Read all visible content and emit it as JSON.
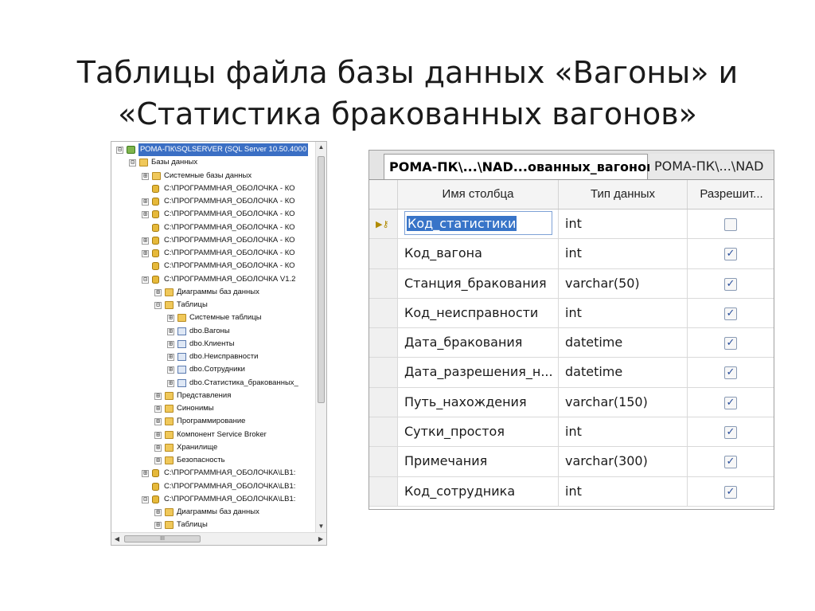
{
  "slide": {
    "title_line1": "Таблицы файла базы данных «Вагоны» и",
    "title_line2": "«Статистика бракованных вагонов»"
  },
  "object_explorer": {
    "nodes": [
      {
        "text": "РОМА-ПК\\SQLSERVER (SQL Server 10.50.4000",
        "expander": "⊟",
        "icon": "server-icon",
        "level": 0,
        "selected": true
      },
      {
        "text": "Базы данных",
        "expander": "⊟",
        "icon": "folder-icon",
        "level": 1
      },
      {
        "text": "Системные базы данных",
        "expander": "⊞",
        "icon": "folder-icon",
        "level": 2
      },
      {
        "text": "C:\\ПРОГРАММНАЯ_ОБОЛОЧКА - КО",
        "expander": "",
        "icon": "database-icon",
        "level": 2
      },
      {
        "text": "C:\\ПРОГРАММНАЯ_ОБОЛОЧКА - КО",
        "expander": "⊞",
        "icon": "database-icon",
        "level": 2
      },
      {
        "text": "C:\\ПРОГРАММНАЯ_ОБОЛОЧКА - КО",
        "expander": "⊞",
        "icon": "database-icon",
        "level": 2
      },
      {
        "text": "C:\\ПРОГРАММНАЯ_ОБОЛОЧКА - КО",
        "expander": "",
        "icon": "database-icon",
        "level": 2
      },
      {
        "text": "C:\\ПРОГРАММНАЯ_ОБОЛОЧКА - КО",
        "expander": "⊞",
        "icon": "database-icon",
        "level": 2
      },
      {
        "text": "C:\\ПРОГРАММНАЯ_ОБОЛОЧКА - КО",
        "expander": "⊞",
        "icon": "database-icon",
        "level": 2
      },
      {
        "text": "C:\\ПРОГРАММНАЯ_ОБОЛОЧКА - КО",
        "expander": "",
        "icon": "database-icon",
        "level": 2
      },
      {
        "text": "C:\\ПРОГРАММНАЯ_ОБОЛОЧКА V1.2",
        "expander": "⊟",
        "icon": "database-icon",
        "level": 2
      },
      {
        "text": "Диаграммы баз данных",
        "expander": "⊞",
        "icon": "folder-icon",
        "level": 3
      },
      {
        "text": "Таблицы",
        "expander": "⊟",
        "icon": "folder-icon",
        "level": 3
      },
      {
        "text": "Системные таблицы",
        "expander": "⊞",
        "icon": "folder-icon",
        "level": 4
      },
      {
        "text": "dbo.Вагоны",
        "expander": "⊞",
        "icon": "table-icon",
        "level": 4
      },
      {
        "text": "dbo.Клиенты",
        "expander": "⊞",
        "icon": "table-icon",
        "level": 4
      },
      {
        "text": "dbo.Неисправности",
        "expander": "⊞",
        "icon": "table-icon",
        "level": 4
      },
      {
        "text": "dbo.Сотрудники",
        "expander": "⊞",
        "icon": "table-icon",
        "level": 4
      },
      {
        "text": "dbo.Статистика_бракованных_",
        "expander": "⊞",
        "icon": "table-icon",
        "level": 4
      },
      {
        "text": "Представления",
        "expander": "⊞",
        "icon": "folder-icon",
        "level": 3
      },
      {
        "text": "Синонимы",
        "expander": "⊞",
        "icon": "folder-icon",
        "level": 3
      },
      {
        "text": "Программирование",
        "expander": "⊞",
        "icon": "folder-icon",
        "level": 3
      },
      {
        "text": "Компонент Service Broker",
        "expander": "⊞",
        "icon": "folder-icon",
        "level": 3
      },
      {
        "text": "Хранилище",
        "expander": "⊞",
        "icon": "folder-icon",
        "level": 3
      },
      {
        "text": "Безопасность",
        "expander": "⊞",
        "icon": "folder-icon",
        "level": 3
      },
      {
        "text": "C:\\ПРОГРАММНАЯ_ОБОЛОЧКА\\LB1:",
        "expander": "⊞",
        "icon": "database-icon",
        "level": 2
      },
      {
        "text": "C:\\ПРОГРАММНАЯ_ОБОЛОЧКА\\LB1:",
        "expander": "",
        "icon": "database-icon",
        "level": 2
      },
      {
        "text": "C:\\ПРОГРАММНАЯ_ОБОЛОЧКА\\LB1:",
        "expander": "⊟",
        "icon": "database-icon",
        "level": 2
      },
      {
        "text": "Диаграммы баз данных",
        "expander": "⊞",
        "icon": "folder-icon",
        "level": 3
      },
      {
        "text": "Таблицы",
        "expander": "⊞",
        "icon": "folder-icon",
        "level": 3
      }
    ],
    "hscroll_thumb_label": "III"
  },
  "designer": {
    "tabs": {
      "active": "РОМА-ПК\\...\\NAD...ованных_вагонов",
      "inactive": "РОМА-ПК\\...\\NAD"
    },
    "headers": {
      "column_name": "Имя столбца",
      "data_type": "Тип данных",
      "allow_nulls": "Разрешит..."
    },
    "rows": [
      {
        "name": "Код_статистики",
        "type": "int",
        "allow_nulls": false,
        "key": true
      },
      {
        "name": "Код_вагона",
        "type": "int",
        "allow_nulls": true
      },
      {
        "name": "Станция_бракования",
        "type": "varchar(50)",
        "allow_nulls": true
      },
      {
        "name": "Код_неисправности",
        "type": "int",
        "allow_nulls": true
      },
      {
        "name": "Дата_бракования",
        "type": "datetime",
        "allow_nulls": true
      },
      {
        "name": "Дата_разрешения_н...",
        "type": "datetime",
        "allow_nulls": true
      },
      {
        "name": "Путь_нахождения",
        "type": "varchar(150)",
        "allow_nulls": true
      },
      {
        "name": "Сутки_простоя",
        "type": "int",
        "allow_nulls": true
      },
      {
        "name": "Примечания",
        "type": "varchar(300)",
        "allow_nulls": true
      },
      {
        "name": "Код_сотрудника",
        "type": "int",
        "allow_nulls": true
      }
    ]
  }
}
